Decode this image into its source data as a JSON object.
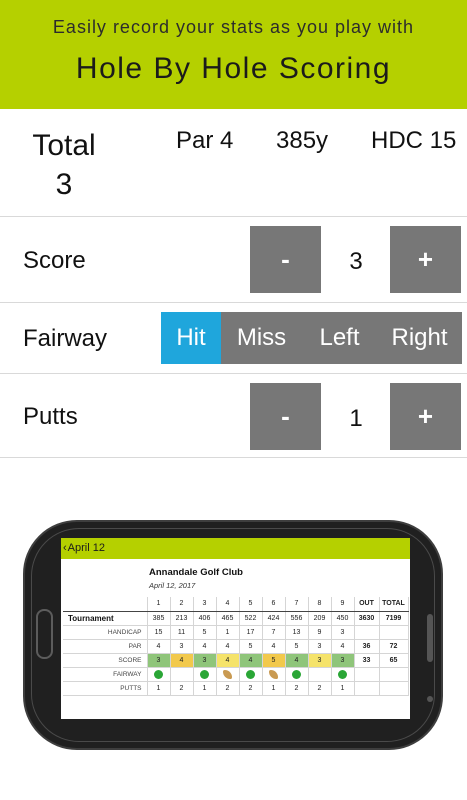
{
  "header": {
    "subtitle": "Easily record your stats as you play with",
    "title": "Hole By Hole Scoring"
  },
  "summary": {
    "total_label": "Total",
    "total_value": "3",
    "par": "Par 4",
    "yards": "385y",
    "handicap": "HDC 15"
  },
  "score": {
    "label": "Score",
    "minus": "-",
    "value": "3",
    "plus": "+"
  },
  "fairway": {
    "label": "Fairway",
    "options": [
      "Hit",
      "Miss",
      "Left",
      "Right"
    ],
    "selected": "Hit"
  },
  "putts": {
    "label": "Putts",
    "minus": "-",
    "value": "1",
    "plus": "+"
  },
  "colors": {
    "accent": "#b5d000",
    "selected": "#1fa6dc",
    "button": "#777777",
    "score_par": "#8fc57a",
    "score_bogey": "#f5e36a",
    "score_double": "#f2c94c"
  },
  "phone_screen": {
    "back_label": "April 12",
    "club": "Annandale Golf Club",
    "date": "April 12, 2017",
    "holes": [
      "1",
      "2",
      "3",
      "4",
      "5",
      "6",
      "7",
      "8",
      "9"
    ],
    "out_label": "OUT",
    "total_label": "TOTAL",
    "tee_name": "Tournament",
    "yards": [
      "385",
      "213",
      "406",
      "465",
      "522",
      "424",
      "556",
      "209",
      "450"
    ],
    "yards_out": "3630",
    "yards_total": "7199",
    "handicap_label": "HANDICAP",
    "handicap": [
      "15",
      "11",
      "5",
      "1",
      "17",
      "7",
      "13",
      "9",
      "3"
    ],
    "par_label": "PAR",
    "par": [
      "4",
      "3",
      "4",
      "4",
      "5",
      "4",
      "5",
      "3",
      "4"
    ],
    "par_out": "36",
    "par_total": "72",
    "score_label": "SCORE",
    "score": [
      "3",
      "4",
      "3",
      "4",
      "4",
      "5",
      "4",
      "3",
      "3"
    ],
    "score_color": [
      "par",
      "double",
      "par",
      "bogey",
      "par",
      "double",
      "par",
      "bogey",
      "par"
    ],
    "score_out": "33",
    "score_total": "65",
    "fairway_label": "FAIRWAY",
    "fairway_icons": [
      "hit",
      "",
      "hit",
      "miss",
      "hit",
      "miss",
      "hit",
      "",
      "hit"
    ],
    "putts_label": "PUTTS",
    "putts": [
      "1",
      "2",
      "1",
      "2",
      "2",
      "1",
      "2",
      "2",
      "1"
    ]
  }
}
